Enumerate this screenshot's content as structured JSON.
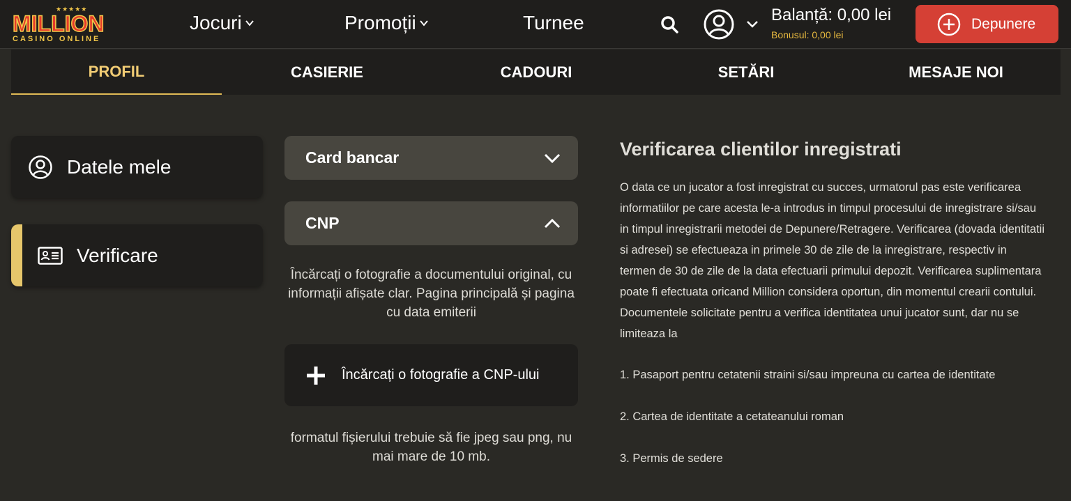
{
  "brand": {
    "stars": "★★★★★",
    "name": "MILLION",
    "tagline": "CASINO ONLINE"
  },
  "header": {
    "nav": [
      {
        "label": "Jocuri",
        "has_dropdown": true
      },
      {
        "label": "Promoții",
        "has_dropdown": true
      },
      {
        "label": "Turnee",
        "has_dropdown": false
      }
    ],
    "balance": "Balanță: 0,00 lei",
    "bonus": "Bonusul: 0,00 lei",
    "deposit_label": "Depunere",
    "icons": [
      "search-icon",
      "user-icon",
      "chevron-down-icon",
      "plus-circle-icon"
    ]
  },
  "tabs": [
    {
      "label": "PROFIL",
      "active": true
    },
    {
      "label": "CASIERIE",
      "active": false
    },
    {
      "label": "CADOURI",
      "active": false
    },
    {
      "label": "SETĂRI",
      "active": false
    },
    {
      "label": "MESAJE NOI",
      "active": false
    }
  ],
  "sidebar": {
    "items": [
      {
        "label": "Datele mele",
        "icon": "user-icon",
        "active": false
      },
      {
        "label": "Verificare",
        "icon": "id-card-icon",
        "active": true
      }
    ]
  },
  "verification": {
    "sections": [
      {
        "label": "Card bancar",
        "expanded": false
      },
      {
        "label": "CNP",
        "expanded": true
      }
    ],
    "instruction": "Încărcați o fotografie a documentului original, cu informații afișate clar. Pagina principală și pagina cu data emiterii",
    "upload_label": "Încărcați o fotografie a CNP-ului",
    "format_note": "formatul fișierului trebuie să fie jpeg sau png, nu mai mare de 10 mb."
  },
  "info": {
    "title": "Verificarea clientilor inregistrati",
    "paragraph": "O data ce un jucator a fost inregistrat cu succes, urmatorul pas este verificarea informatiilor pe care acesta le-a introdus in timpul procesului de inregistrare si/sau in timpul inregistrarii metodei de Depunere/Retragere. Verificarea (dovada identitatii si adresei) se efectueaza in primele 30 de zile de la inregistrare, respectiv in termen de 30 de zile de la data efectuarii primului depozit. Verificarea suplimentara poate fi efectuata oricand Million considera oportun, din momentul crearii contului. Documentele solicitate pentru a verifica identitatea unui jucator sunt, dar nu se limiteaza la",
    "list": [
      "1. Pasaport pentru cetatenii straini si/sau impreuna cu cartea de identitate",
      "2. Cartea de identitate a cetateanului roman",
      "3. Permis de sedere"
    ]
  },
  "colors": {
    "background": "#2a2925",
    "panel": "#1f1e1c",
    "accordion": "#48463f",
    "accent_gold": "#e6c66b",
    "deposit_red": "#d54035"
  }
}
